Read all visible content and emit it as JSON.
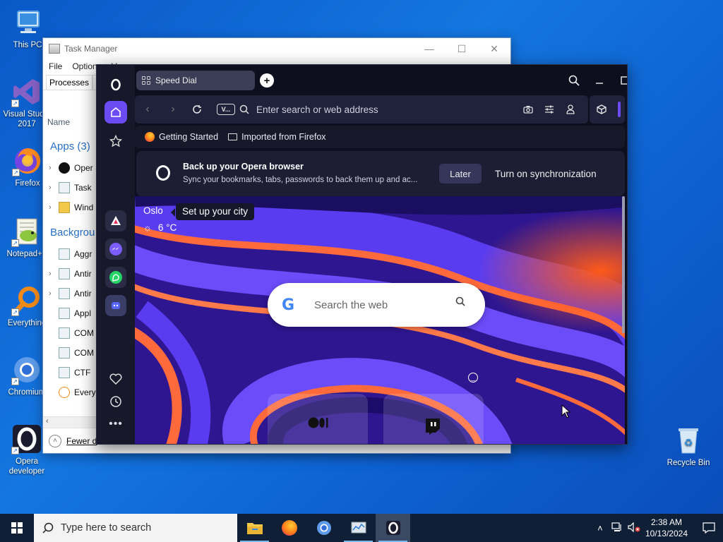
{
  "desktop": {
    "icons": [
      {
        "label": "This PC"
      },
      {
        "label": "Visual Studio 2017"
      },
      {
        "label": "Firefox"
      },
      {
        "label": "Notepad++"
      },
      {
        "label": "Everything"
      },
      {
        "label": "Chromium"
      },
      {
        "label": "Opera developer"
      },
      {
        "label": "Recycle Bin"
      }
    ]
  },
  "task_manager": {
    "title": "Task Manager",
    "menu": [
      "File",
      "Options",
      "V"
    ],
    "tabs": [
      "Processes",
      "P"
    ],
    "column_name": "Name",
    "group_apps": "Apps (3)",
    "group_background": "Backgrou",
    "apps": [
      "Oper",
      "Task",
      "Wind"
    ],
    "background": [
      "Aggr",
      "Antir",
      "Antir",
      "Appl",
      "COM",
      "COM",
      "CTF",
      "Every"
    ],
    "fewer_details": "Fewer d",
    "controls": {
      "minimize": "—",
      "maximize": "☐",
      "close": "✕"
    }
  },
  "opera": {
    "tab_title": "Speed Dial",
    "new_tab": "+",
    "address_placeholder": "Enter search or web address",
    "vpn_label": "V...",
    "bookmarks": [
      {
        "label": "Getting Started",
        "icon": "firefox-icon"
      },
      {
        "label": "Imported from Firefox",
        "icon": "folder-icon"
      }
    ],
    "sync_banner": {
      "title": "Back up your Opera browser",
      "subtitle": "Sync your bookmarks, tabs, passwords to back them up and ac...",
      "later": "Later",
      "action": "Turn on synchronization"
    },
    "weather": {
      "city": "Oslo",
      "tooltip": "Set up your city",
      "temperature": "6 °C"
    },
    "search": {
      "placeholder": "Search the web",
      "engine": "G"
    },
    "speed_dials": [
      {
        "name": "Medium",
        "glyph": "●●|"
      },
      {
        "name": "Twitch",
        "glyph": "▣"
      }
    ],
    "accent_color": "#6b4cf3"
  },
  "taskbar": {
    "search_placeholder": "Type here to search",
    "apps": [
      "file-explorer",
      "firefox",
      "chromium",
      "task-manager",
      "opera"
    ],
    "time": "2:38 AM",
    "date": "10/13/2024"
  }
}
